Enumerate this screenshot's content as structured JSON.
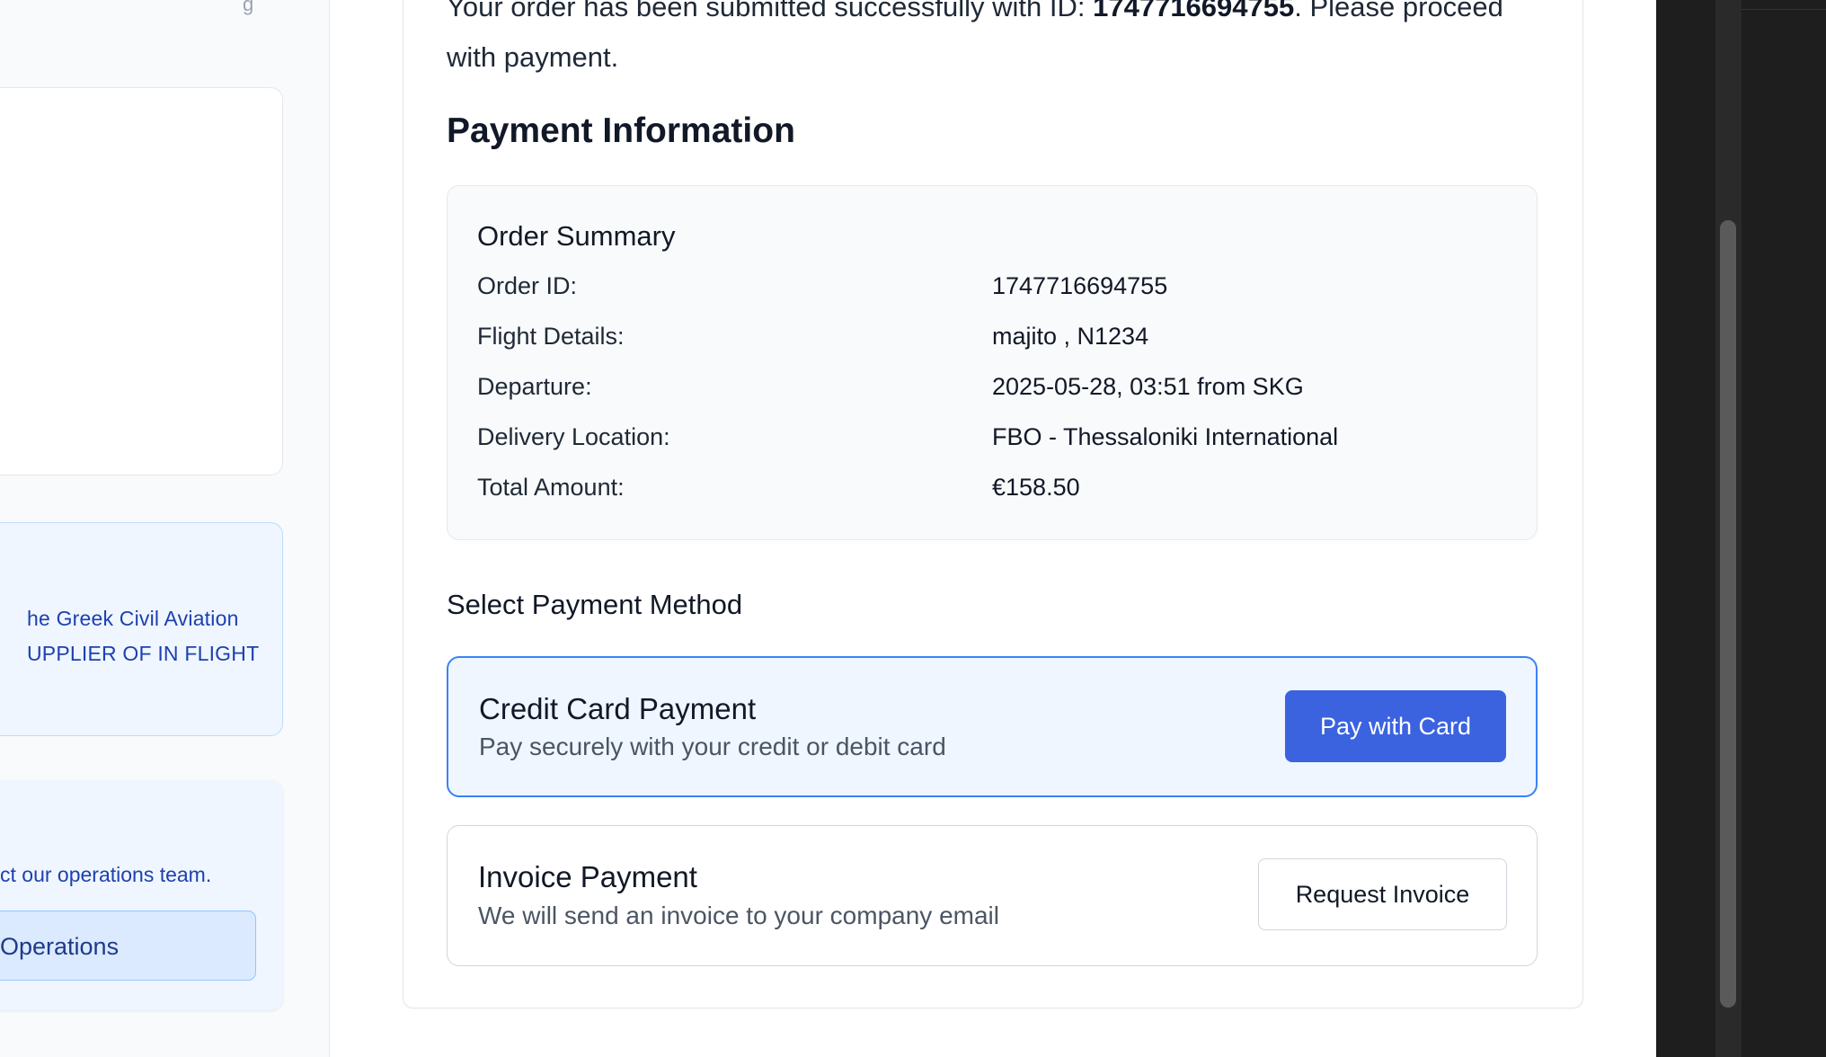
{
  "sidebar": {
    "top_mark": "g",
    "notice_line_1": "he Greek Civil Aviation",
    "notice_line_2": "UPPLIER OF IN FLIGHT",
    "contact_text": "ct our operations team.",
    "contact_button_label": "Operations"
  },
  "confirmation": {
    "text_before": "Your order has been submitted successfully with ID: ",
    "order_id": "1747716694755",
    "text_after": ". Please proceed with payment."
  },
  "payment_info_title": "Payment Information",
  "order_summary": {
    "title": "Order Summary",
    "rows": [
      {
        "label": "Order ID:",
        "value": "1747716694755"
      },
      {
        "label": "Flight Details:",
        "value": "majito , N1234"
      },
      {
        "label": "Departure:",
        "value": "2025-05-28, 03:51 from SKG"
      },
      {
        "label": "Delivery Location:",
        "value": "FBO - Thessaloniki International"
      },
      {
        "label": "Total Amount:",
        "value": "€158.50"
      }
    ]
  },
  "payment_methods": {
    "title": "Select Payment Method",
    "credit_card": {
      "title": "Credit Card Payment",
      "description": "Pay securely with your credit or debit card",
      "button_label": "Pay with Card"
    },
    "invoice": {
      "title": "Invoice Payment",
      "description": "We will send an invoice to your company email",
      "button_label": "Request Invoice"
    }
  },
  "colors": {
    "primary": "#3b63e0",
    "selected_bg": "#eff6ff",
    "selected_border": "#3b82f6",
    "notice_text": "#1e40af"
  }
}
